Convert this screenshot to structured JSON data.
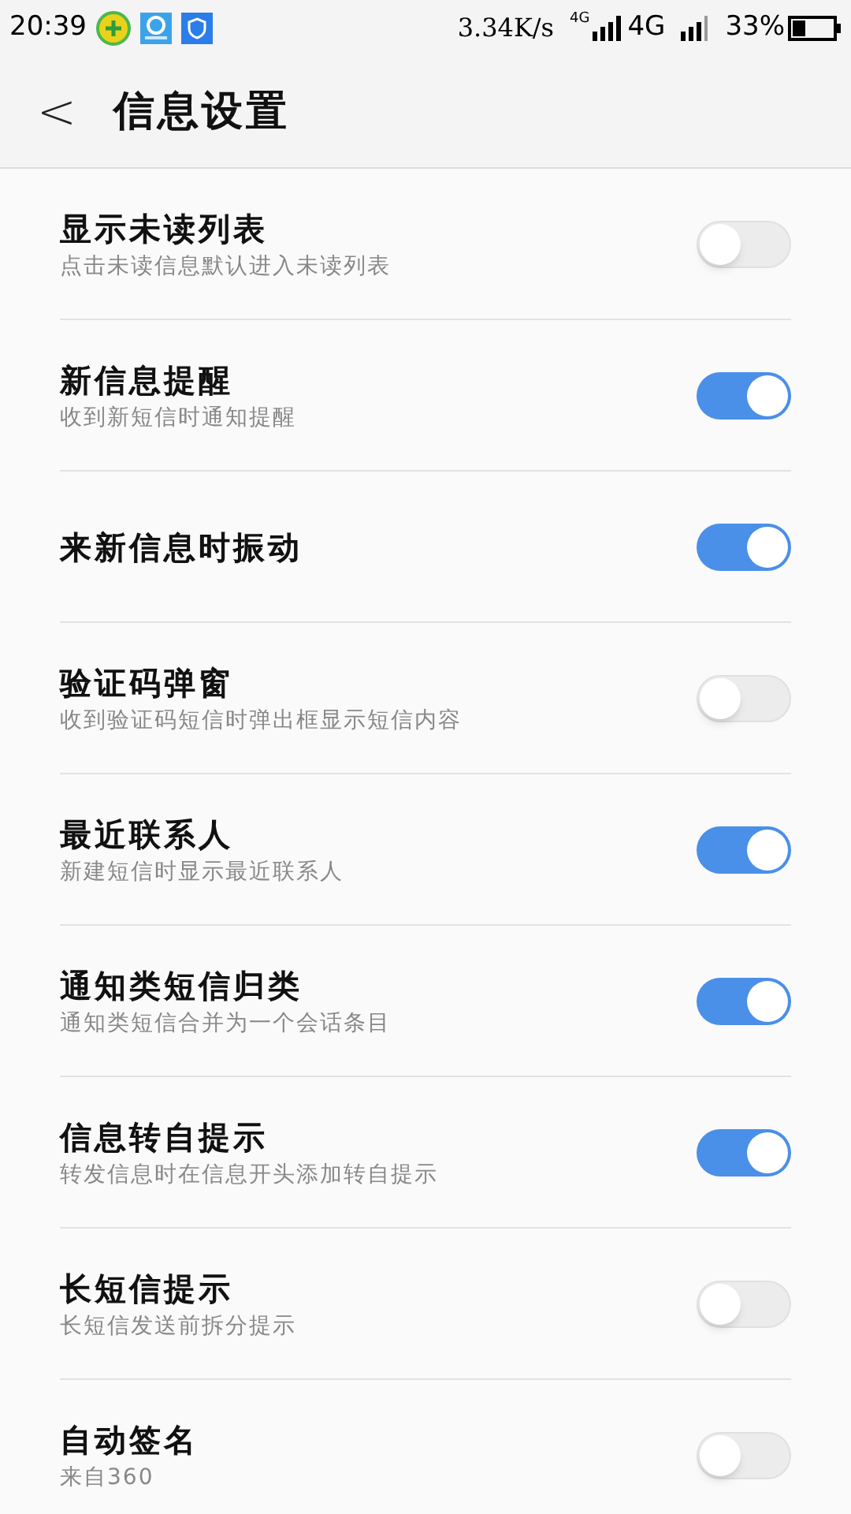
{
  "status_bar": {
    "time": "20:39",
    "speed": "3.34K/s",
    "network_small": "4G",
    "network": "4G",
    "battery": "33%"
  },
  "header": {
    "back": "<",
    "title": "信息设置"
  },
  "settings": [
    {
      "title": "显示未读列表",
      "subtitle": "点击未读信息默认进入未读列表",
      "on": false
    },
    {
      "title": "新信息提醒",
      "subtitle": "收到新短信时通知提醒",
      "on": true
    },
    {
      "title": "来新信息时振动",
      "on": true
    },
    {
      "title": "验证码弹窗",
      "subtitle": "收到验证码短信时弹出框显示短信内容",
      "on": false
    },
    {
      "title": "最近联系人",
      "subtitle": "新建短信时显示最近联系人",
      "on": true
    },
    {
      "title": "通知类短信归类",
      "subtitle": "通知类短信合并为一个会话条目",
      "on": true
    },
    {
      "title": "信息转自提示",
      "subtitle": "转发信息时在信息开头添加转自提示",
      "on": true
    },
    {
      "title": "长短信提示",
      "subtitle": "长短信发送前拆分提示",
      "on": false
    },
    {
      "title": "自动签名",
      "subtitle": "来自360",
      "on": false
    }
  ]
}
